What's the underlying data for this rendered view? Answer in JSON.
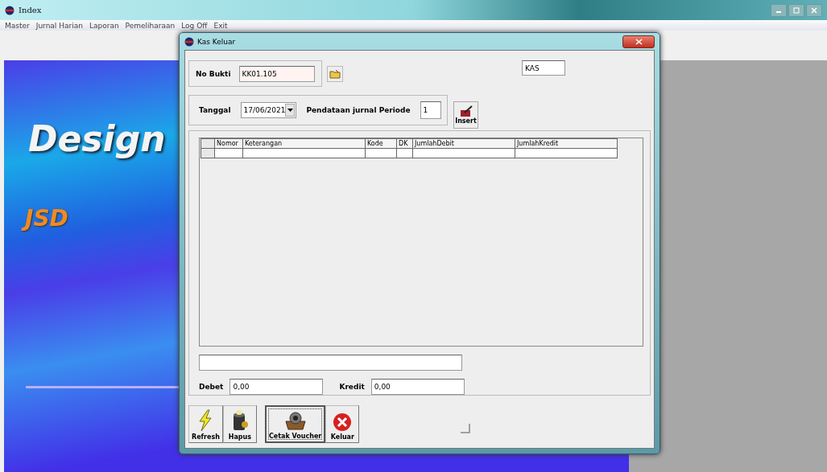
{
  "window": {
    "title": "Index"
  },
  "menu": [
    {
      "label": "Master"
    },
    {
      "label": "Jurnal Harian"
    },
    {
      "label": "Laporan"
    },
    {
      "label": "Pemeliharaan"
    },
    {
      "label": "Log Off"
    },
    {
      "label": "Exit"
    }
  ],
  "banner": {
    "title": "Design",
    "subtitle": "JSD"
  },
  "dialog": {
    "title": "Kas Keluar",
    "no_bukti": {
      "label": "No Bukti",
      "value": "KK01.105"
    },
    "kas_field": {
      "value": "KAS"
    },
    "tanggal": {
      "label": "Tanggal",
      "value": "17/06/2021"
    },
    "periode": {
      "label": "Pendataan jurnal Periode",
      "value": "1"
    },
    "insert_button": {
      "label": "Insert"
    },
    "grid": {
      "columns": [
        "Nomor",
        "Keterangan",
        "Kode",
        "DK",
        "JumlahDebit",
        "JumlahKredit"
      ]
    },
    "debet": {
      "label": "Debet",
      "value": "0,00"
    },
    "kredit": {
      "label": "Kredit",
      "value": "0,00"
    },
    "buttons": [
      {
        "label": "Refresh",
        "kind": "refresh",
        "focused": false
      },
      {
        "label": "Hapus",
        "kind": "delete",
        "focused": false
      },
      {
        "label": "Cetak Voucher",
        "kind": "print",
        "focused": true
      },
      {
        "label": "Keluar",
        "kind": "exit",
        "focused": false
      }
    ]
  }
}
